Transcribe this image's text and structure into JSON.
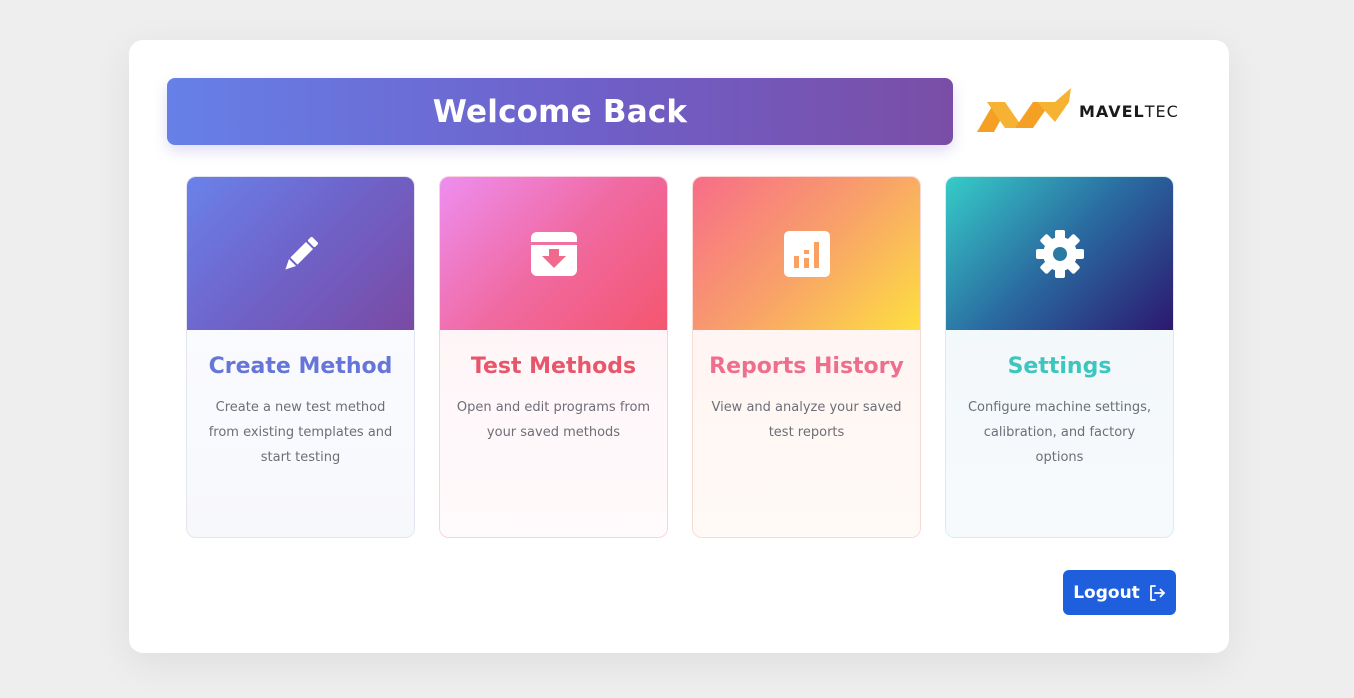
{
  "header": {
    "title": "Welcome Back"
  },
  "logo": {
    "text_bold": "MAVEL",
    "text_light": "TEC",
    "icon": "maveltec-logo-mark",
    "colors": [
      "#f5a623",
      "#f0b840"
    ]
  },
  "cards": [
    {
      "title": "Create Method",
      "description": "Create a new test method from existing templates and start testing",
      "icon": "pencil-icon",
      "accent": "#6576d8"
    },
    {
      "title": "Test Methods",
      "description": "Open and edit programs from your saved methods",
      "icon": "archive-download-icon",
      "accent": "#e8566c"
    },
    {
      "title": "Reports History",
      "description": "View and analyze your saved test reports",
      "icon": "bar-chart-icon",
      "accent": "#ee6f8d"
    },
    {
      "title": "Settings",
      "description": "Configure machine settings, calibration, and factory options",
      "icon": "gear-icon",
      "accent": "#3cc6c0"
    }
  ],
  "footer": {
    "logout_label": "Logout",
    "logout_icon": "logout-icon",
    "logout_color": "#1f5fde"
  }
}
